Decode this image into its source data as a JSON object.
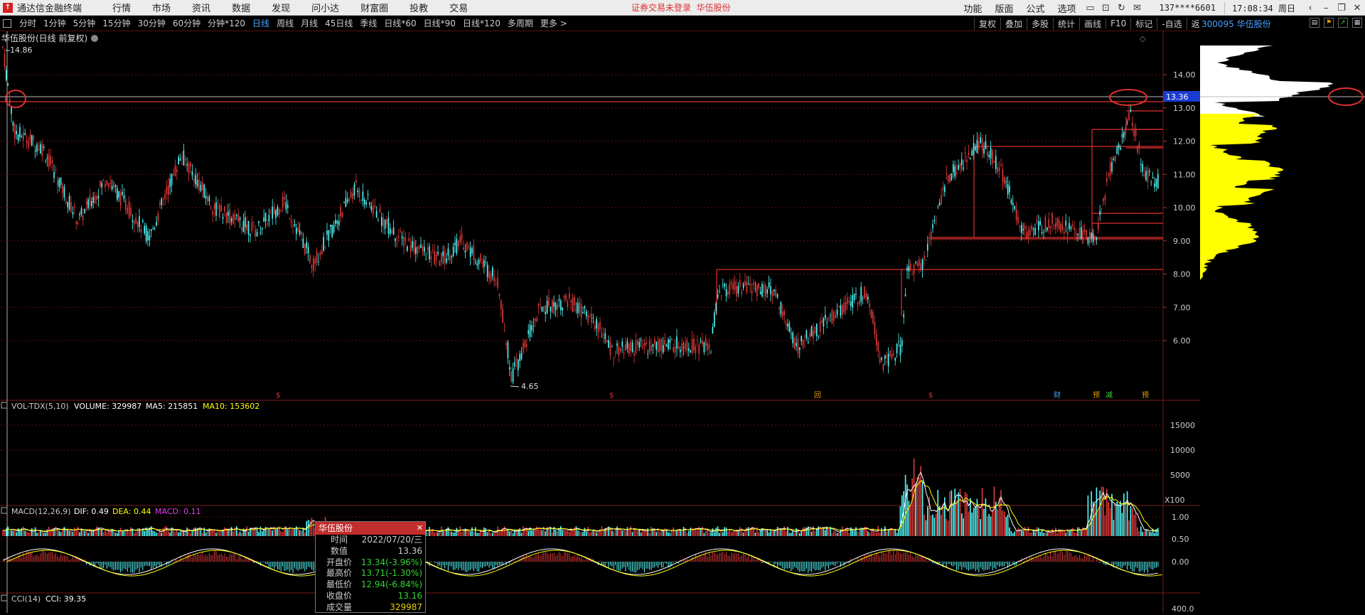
{
  "title_bar": {
    "app_name": "通达信金融终端",
    "menu": [
      "行情",
      "市场",
      "资讯",
      "数据",
      "发现",
      "问小达",
      "财富圈",
      "投教",
      "交易"
    ],
    "notice": "证券交易未登录",
    "stock_name": "华伍股份",
    "right_menu": [
      "功能",
      "版面",
      "公式",
      "选项"
    ],
    "phone": "137****6601",
    "time": "17:08:34 周日"
  },
  "period_bar": {
    "items": [
      "分时",
      "1分钟",
      "5分钟",
      "15分钟",
      "30分钟",
      "60分钟",
      "分钟*120",
      "日线",
      "周线",
      "月线",
      "45日线",
      "季线",
      "日线*60",
      "日线*90",
      "日线*120",
      "多周期",
      "更多 >"
    ],
    "active": "日线",
    "tools": [
      "复权",
      "叠加",
      "多股",
      "统计",
      "画线",
      "F10",
      "标记",
      "-自选",
      "返回"
    ]
  },
  "right_panel": {
    "code_label": "300095 华伍股份"
  },
  "chart_data": [
    {
      "type": "candlestick",
      "title": "华伍股份(日线 前复权)",
      "y_ticks": [
        "14.00",
        "13.00",
        "12.00",
        "11.00",
        "10.00",
        "9.00",
        "8.00",
        "7.00",
        "6.00"
      ],
      "high_label": "14.86",
      "low_label": "4.65",
      "cursor_price": "13.36",
      "markers": [
        "$",
        "$",
        "回",
        "$",
        "财",
        "预",
        "减",
        "预"
      ]
    },
    {
      "type": "bar",
      "title": "VOL-TDX(5,10)",
      "volume": "VOLUME: 329987",
      "ma5": "MA5: 215851",
      "ma10": "MA10: 153602",
      "y_ticks": [
        "15000",
        "10000",
        "5000"
      ],
      "unit": "X100"
    },
    {
      "type": "bar",
      "title": "MACD(12,26,9)",
      "dif": "DIF: 0.49",
      "dea": "DEA: 0.44",
      "macd": "MACD: 0.11",
      "y_ticks": [
        "1.00",
        "0.50",
        "0.00"
      ]
    },
    {
      "type": "line",
      "title": "CCI(14)",
      "cci": "CCI: 39.35",
      "y_ticks": [
        "400.0"
      ]
    }
  ],
  "tooltip": {
    "title": "华伍股份",
    "rows": [
      {
        "k": "时间",
        "v": "2022/07/20/三"
      },
      {
        "k": "数值",
        "v": "13.36"
      },
      {
        "k": "开盘价",
        "v": "13.34(-3.96%)"
      },
      {
        "k": "最高价",
        "v": "13.71(-1.30%)"
      },
      {
        "k": "最低价",
        "v": "12.94(-6.84%)"
      },
      {
        "k": "收盘价",
        "v": "13.16"
      },
      {
        "k": "成交量",
        "v": "329987"
      }
    ]
  },
  "colors": {
    "up": "#e03a3a",
    "down": "#54ffff",
    "ma_white": "#ffffff",
    "ma_yellow": "#ffff00",
    "grid": "#5a1010"
  }
}
